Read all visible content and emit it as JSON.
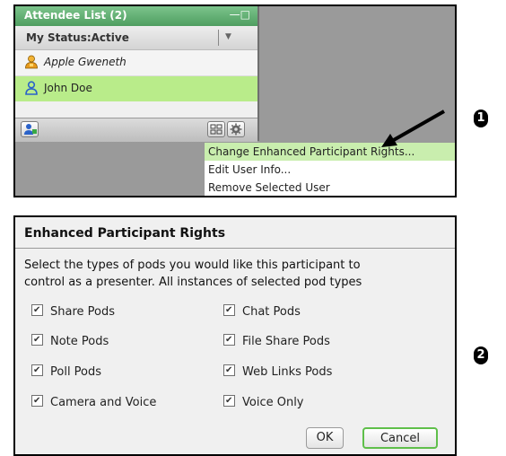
{
  "attendee_pod": {
    "title": "Attendee List (2)",
    "window_controls": "—□",
    "status_label": "My Status:Active",
    "status_dropdown_glyph": "▼",
    "attendees": [
      {
        "name": "Apple Gweneth",
        "role": "host",
        "icon": "host-user-icon"
      },
      {
        "name": "John Doe",
        "role": "participant",
        "icon": "participant-user-icon",
        "selected": true
      }
    ]
  },
  "context_menu": {
    "items": [
      {
        "label": "Change Enhanced Participant Rights...",
        "highlighted": true
      },
      {
        "label": "Edit User Info..."
      },
      {
        "label": "Remove Selected User"
      }
    ]
  },
  "step_badges": [
    "1",
    "2"
  ],
  "dialog": {
    "title": "Enhanced Participant Rights",
    "description": "Select the types of pods you would like this participant to\ncontrol as a presenter. All instances of selected pod types",
    "checkboxes": [
      {
        "label": "Share Pods",
        "checked": true
      },
      {
        "label": "Chat Pods",
        "checked": true
      },
      {
        "label": "Note Pods",
        "checked": true
      },
      {
        "label": "File Share Pods",
        "checked": true
      },
      {
        "label": "Poll Pods",
        "checked": true
      },
      {
        "label": "Web Links Pods",
        "checked": true
      },
      {
        "label": "Camera and Voice",
        "checked": true
      },
      {
        "label": "Voice Only",
        "checked": true
      }
    ],
    "ok_label": "OK",
    "cancel_label": "Cancel"
  },
  "colors": {
    "pod_header": "#5aa86b",
    "selected_row": "#b9ec8a",
    "menu_highlight": "#c9eeae",
    "cancel_border": "#5fbf4a"
  }
}
